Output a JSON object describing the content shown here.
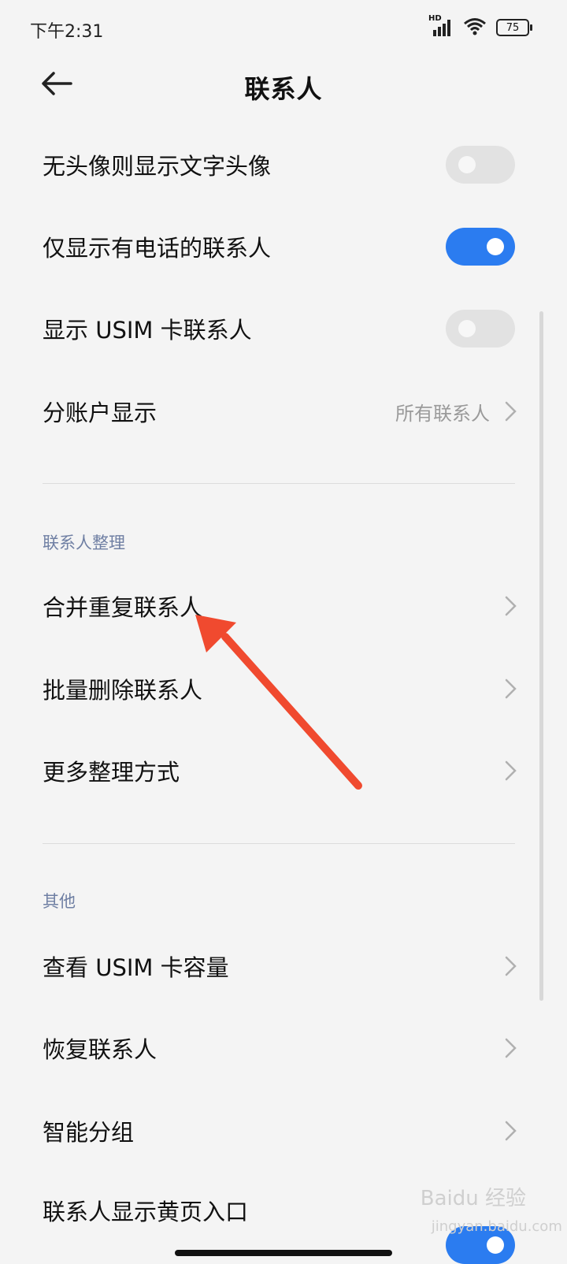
{
  "status_bar": {
    "time": "下午2:31",
    "network": "HD",
    "battery": "75"
  },
  "header": {
    "title": "联系人"
  },
  "settings": {
    "no_avatar_text": {
      "label": "无头像则显示文字头像",
      "toggle_on": false
    },
    "only_with_phone": {
      "label": "仅显示有电话的联系人",
      "toggle_on": true
    },
    "show_usim": {
      "label": "显示 USIM 卡联系人",
      "toggle_on": false
    },
    "account_display": {
      "label": "分账户显示",
      "value": "所有联系人"
    }
  },
  "section_organize": {
    "title": "联系人整理",
    "items": [
      "合并重复联系人",
      "批量删除联系人",
      "更多整理方式"
    ]
  },
  "section_other": {
    "title": "其他",
    "items": [
      "查看 USIM 卡容量",
      "恢复联系人",
      "智能分组",
      "联系人显示黄页入口"
    ]
  },
  "colors": {
    "accent": "#2b7cf0",
    "annotation_arrow": "#f04a2f"
  },
  "watermark": {
    "brand": "Baidu 经验",
    "url": "jingyan.baidu.com"
  }
}
